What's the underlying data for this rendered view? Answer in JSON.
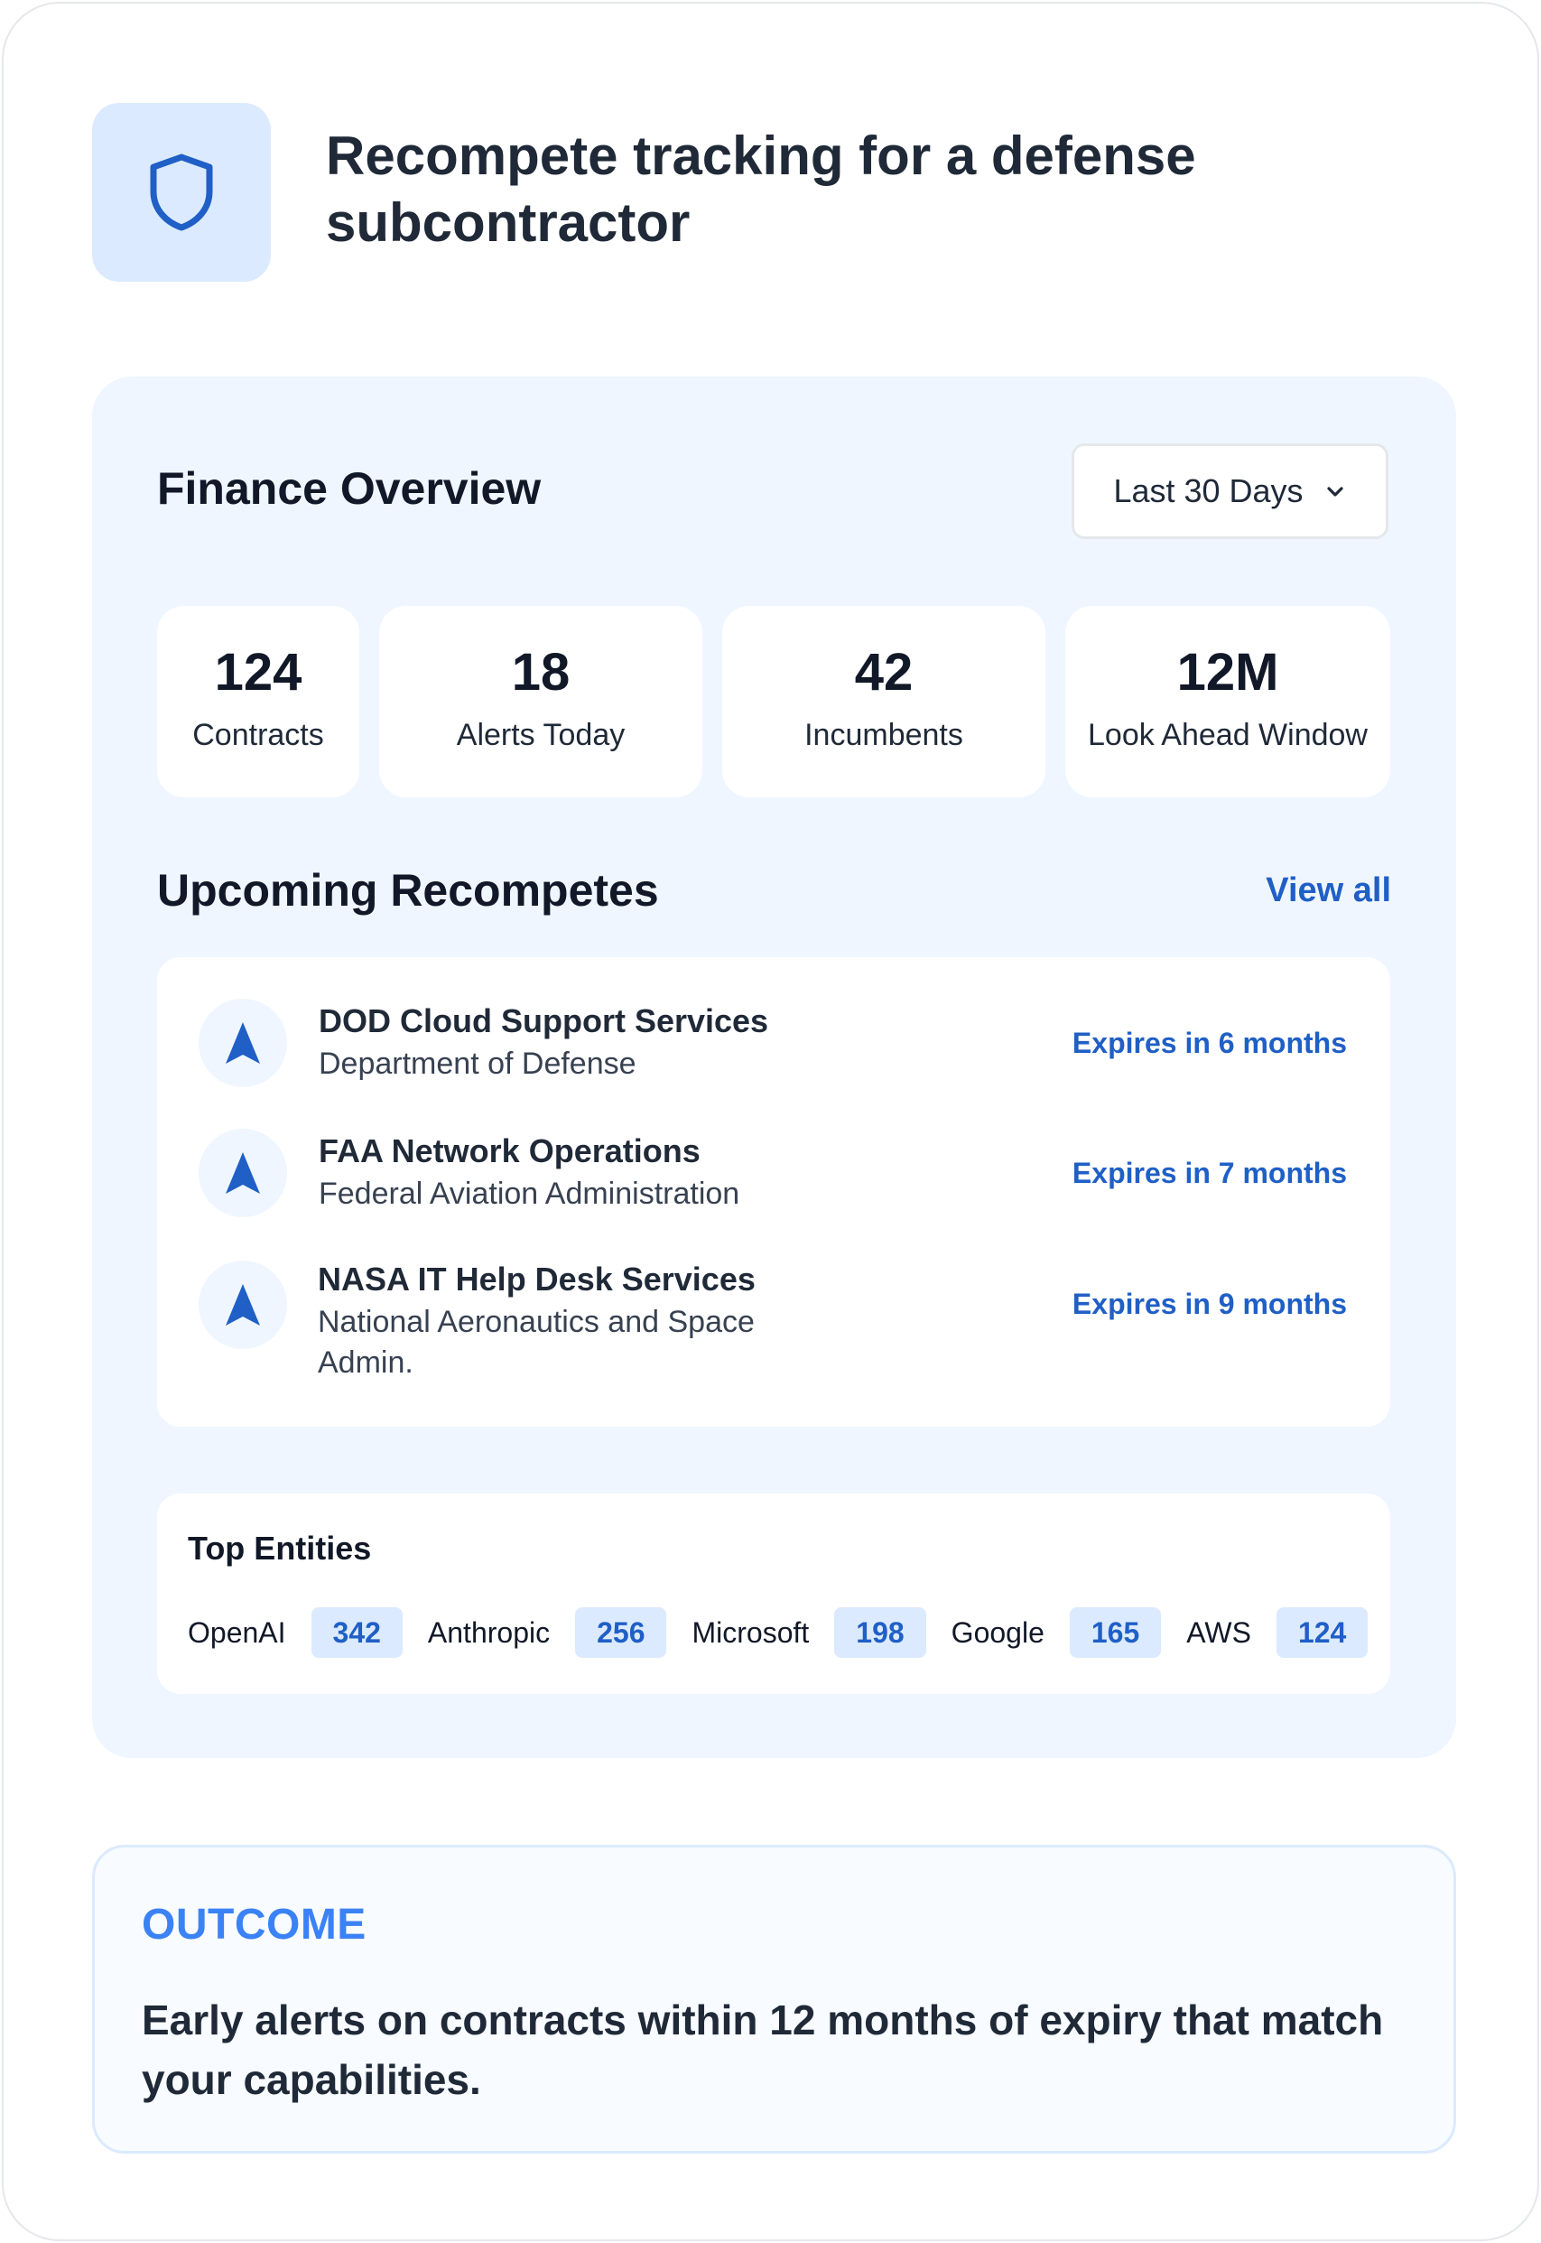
{
  "hero": {
    "title": "Recompete tracking for a defense subcontractor",
    "icon": "shield-icon"
  },
  "finance": {
    "title": "Finance Overview",
    "range_label": "Last 30 Days",
    "stats": [
      {
        "value": "124",
        "label": "Contracts"
      },
      {
        "value": "18",
        "label": "Alerts Today"
      },
      {
        "value": "42",
        "label": "Incumbents"
      },
      {
        "value": "12M",
        "label": "Look Ahead Window"
      }
    ]
  },
  "recompetes": {
    "title": "Upcoming Recompetes",
    "view_all_label": "View all",
    "items": [
      {
        "name": "DOD Cloud Support Services",
        "agency": "Department of Defense",
        "expiry": "Expires in 6 months",
        "icon": "navigation-arrow-icon"
      },
      {
        "name": "FAA Network Operations",
        "agency": "Federal Aviation Administration",
        "expiry": "Expires in 7 months",
        "icon": "navigation-arrow-icon"
      },
      {
        "name": "NASA IT Help Desk Services",
        "agency": "National Aeronautics and Space Admin.",
        "expiry": "Expires in 9 months",
        "icon": "navigation-arrow-icon"
      }
    ]
  },
  "entities": {
    "title": "Top Entities",
    "items": [
      {
        "name": "OpenAI",
        "count": "342"
      },
      {
        "name": "Anthropic",
        "count": "256"
      },
      {
        "name": "Microsoft",
        "count": "198"
      },
      {
        "name": "Google",
        "count": "165"
      },
      {
        "name": "AWS",
        "count": "124"
      }
    ]
  },
  "outcome": {
    "label": "OUTCOME",
    "text": "Early alerts on contracts within 12 months of expiry that match your capabilities."
  },
  "colors": {
    "accent": "#1f5fc6",
    "panel_bg": "#eff6ff",
    "icon_bg": "#dbeafe",
    "outcome_label": "#3b82f6"
  }
}
